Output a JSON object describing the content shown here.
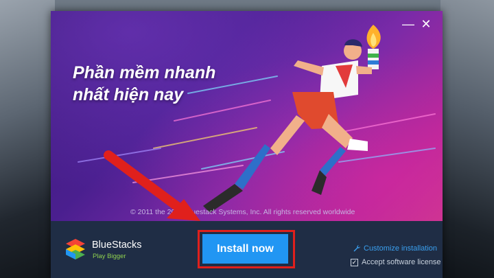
{
  "window": {
    "minimize_label": "—",
    "close_label": "✕"
  },
  "banner": {
    "headline_line1": "Phần mềm nhanh",
    "headline_line2": "nhất hiện nay",
    "copyright": "© 2011 the 2021 Bluestack Systems, Inc. All rights reserved worldwide"
  },
  "footer": {
    "brand_name": "BlueStacks",
    "brand_tagline": "Play Bigger",
    "install_label": "Install now",
    "customize_label": "Customize installation",
    "accept_label": "Accept software license",
    "accept_checked": true
  },
  "colors": {
    "install_button": "#2196f3",
    "highlight_box": "#e0201c",
    "link": "#3aa0f0",
    "tagline": "#8fd14f"
  },
  "icons": [
    "wrench-icon",
    "checkbox-icon",
    "bluestacks-logo-icon",
    "minimize-icon",
    "close-icon"
  ]
}
